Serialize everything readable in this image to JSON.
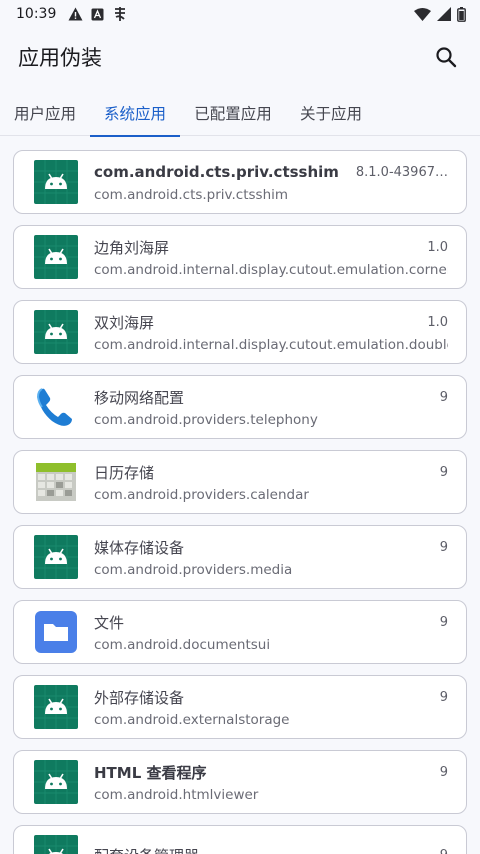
{
  "status_bar": {
    "time": "10:39",
    "icons_left": [
      "alert-icon",
      "notification-a-icon",
      "notification-glyph-icon"
    ],
    "icons_right": [
      "wifi-icon",
      "signal-icon",
      "battery-icon"
    ]
  },
  "app_bar": {
    "title": "应用伪装",
    "search_icon": "search-icon"
  },
  "tabs": [
    {
      "label": "用户应用",
      "active": false
    },
    {
      "label": "系统应用",
      "active": true
    },
    {
      "label": "已配置应用",
      "active": false
    },
    {
      "label": "关于应用",
      "active": false
    }
  ],
  "apps": [
    {
      "name": "com.android.cts.priv.ctsshim",
      "version": "8.1.0-43967…",
      "package": "com.android.cts.priv.ctsshim",
      "icon": "android-icon",
      "bold": true
    },
    {
      "name": "边角刘海屏",
      "version": "1.0",
      "package": "com.android.internal.display.cutout.emulation.corner",
      "icon": "android-icon"
    },
    {
      "name": "双刘海屏",
      "version": "1.0",
      "package": "com.android.internal.display.cutout.emulation.double",
      "icon": "android-icon"
    },
    {
      "name": "移动网络配置",
      "version": "9",
      "package": "com.android.providers.telephony",
      "icon": "phone-icon"
    },
    {
      "name": "日历存储",
      "version": "9",
      "package": "com.android.providers.calendar",
      "icon": "calendar-icon"
    },
    {
      "name": "媒体存储设备",
      "version": "9",
      "package": "com.android.providers.media",
      "icon": "android-icon"
    },
    {
      "name": "文件",
      "version": "9",
      "package": "com.android.documentsui",
      "icon": "folder-icon"
    },
    {
      "name": "外部存储设备",
      "version": "9",
      "package": "com.android.externalstorage",
      "icon": "android-icon"
    },
    {
      "name": "HTML 查看程序",
      "version": "9",
      "package": "com.android.htmlviewer",
      "icon": "android-icon",
      "bold": true
    },
    {
      "name": "配套设备管理器",
      "version": "9",
      "package": "",
      "icon": "android-icon"
    }
  ],
  "colors": {
    "accent": "#1b5fc9",
    "android_green": "#0f7a5f",
    "folder_blue": "#4a7fe8"
  }
}
